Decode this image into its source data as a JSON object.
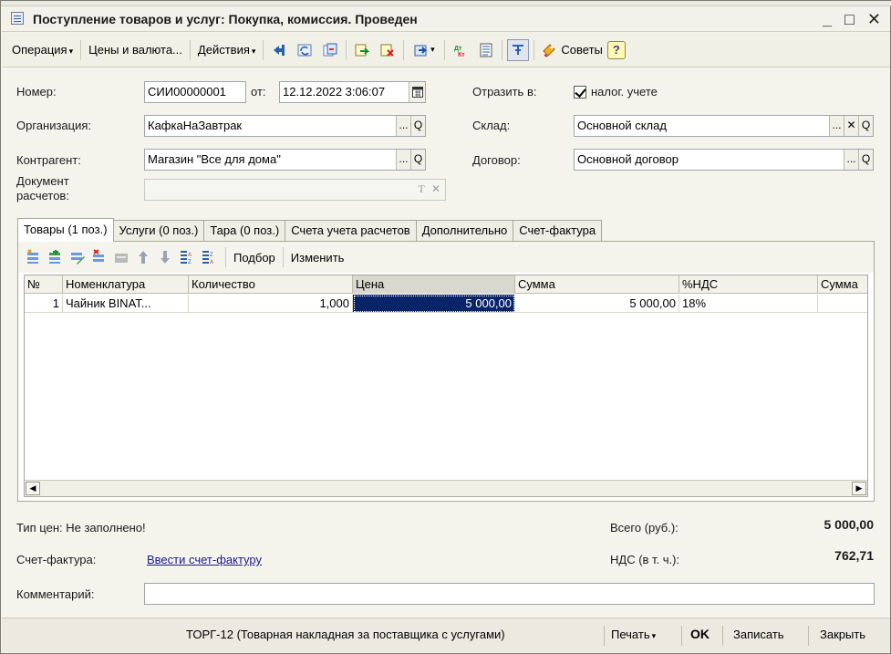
{
  "window": {
    "title": "Поступление товаров и услуг: Покупка, комиссия. Проведен",
    "btn_minimize": "_",
    "btn_maximize": "□",
    "btn_close": "✕"
  },
  "toolbar": {
    "operation_label": "Операция",
    "prices_label": "Цены и валюта...",
    "actions_label": "Действия",
    "tips_label": "Советы",
    "help_label": "?",
    "dropdown_glyph": "▾"
  },
  "header": {
    "number_label": "Номер:",
    "number_value": "СИИ00000001",
    "date_label": "от:",
    "date_value": "12.12.2022  3:06:07",
    "reflect_label": "Отразить в:",
    "tax_label": "налог. учете",
    "tax_checked": true,
    "org_label": "Организация:",
    "org_value": "КафкаНаЗавтрак",
    "warehouse_label": "Склад:",
    "warehouse_value": "Основной склад",
    "counterparty_label": "Контрагент:",
    "counterparty_value": "Магазин \"Все для дома\"",
    "contract_label": "Договор:",
    "contract_value": "Основной договор",
    "settle_doc_label_1": "Документ",
    "settle_doc_label_2": "расчетов:",
    "settle_doc_value": "",
    "btn_ellipsis": "...",
    "btn_search": "Q",
    "btn_clear": "✕",
    "btn_type": "T"
  },
  "tabs": [
    {
      "label": "Товары (1 поз.)",
      "active": true
    },
    {
      "label": "Услуги (0 поз.)",
      "active": false
    },
    {
      "label": "Тара (0 поз.)",
      "active": false
    },
    {
      "label": "Счета учета расчетов",
      "active": false
    },
    {
      "label": "Дополнительно",
      "active": false
    },
    {
      "label": "Счет-фактура",
      "active": false
    }
  ],
  "panel_toolbar": {
    "pick_label": "Подбор",
    "change_label": "Изменить"
  },
  "table": {
    "columns": [
      "№",
      "Номенклатура",
      "Количество",
      "Цена",
      "Сумма",
      "%НДС",
      "Сумма"
    ],
    "rows": [
      {
        "n": "1",
        "item": "Чайник BINAT...",
        "qty": "1,000",
        "price": "5 000,00",
        "sum": "5 000,00",
        "vat": "18%",
        "vat_sum": ""
      }
    ]
  },
  "footer": {
    "price_type": "Тип цен: Не заполнено!",
    "total_label": "Всего (руб.):",
    "total_value": "5 000,00",
    "invoice_label": "Счет-фактура:",
    "invoice_link": "Ввести счет-фактуру",
    "vat_label": "НДС (в т. ч.):",
    "vat_value": "762,71",
    "comment_label": "Комментарий:",
    "comment_value": ""
  },
  "statusbar": {
    "torg_label": "ТОРГ-12 (Товарная накладная за поставщика с услугами)",
    "print_label": "Печать",
    "ok_label": "OK",
    "save_label": "Записать",
    "close_label": "Закрыть"
  },
  "colors": {
    "selection": "#0a246a",
    "window_bg": "#f5f4ec",
    "link": "#1a1a8a"
  }
}
